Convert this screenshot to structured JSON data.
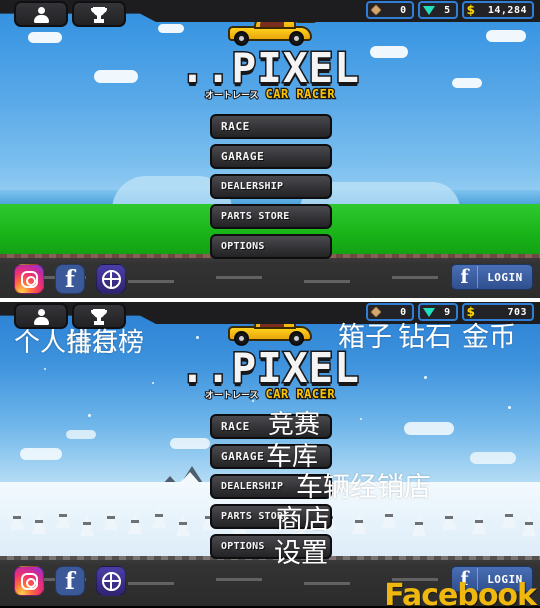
{
  "app": {
    "title": "Pixel Car Racer",
    "logo_main": "PIXEL",
    "logo_prefix": "..",
    "logo_jp": "オートレース",
    "logo_sub": "CAR RACER"
  },
  "colors": {
    "accent_blue": "#2f7fd6",
    "coin_gold": "#ffd900",
    "gem_teal": "#22dfc0",
    "box_tan": "#d4a870",
    "facebook_blue": "#3b5998",
    "menu_button": "#3a3a3e",
    "watermark_gold": "#f0b80e"
  },
  "panels": [
    {
      "id": "summer",
      "scene": "grass-day",
      "topbar": {
        "profile_icon": "person-icon",
        "trophy_icon": "trophy-icon",
        "chips": [
          {
            "icon": "crate-icon",
            "label": "boxes",
            "value": "0"
          },
          {
            "icon": "gem-icon",
            "label": "gems",
            "value": "5"
          },
          {
            "icon": "coin-icon",
            "label": "coins",
            "value": "14,284"
          }
        ]
      },
      "menu": [
        {
          "label": "RACE"
        },
        {
          "label": "GARAGE"
        },
        {
          "label": "DEALERSHIP"
        },
        {
          "label": "PARTS STORE"
        },
        {
          "label": "OPTIONS"
        }
      ],
      "bottombar": {
        "social": [
          {
            "icon": "instagram-icon",
            "label": "Instagram"
          },
          {
            "icon": "facebook-icon",
            "label": "Facebook"
          },
          {
            "icon": "globe-icon",
            "label": "Website"
          }
        ],
        "login": {
          "icon": "facebook-f-icon",
          "label": "LOGIN"
        }
      },
      "annotations": []
    },
    {
      "id": "winter",
      "scene": "snow-mountain",
      "topbar": {
        "profile_icon": "person-icon",
        "trophy_icon": "trophy-icon",
        "chips": [
          {
            "icon": "crate-icon",
            "label": "boxes",
            "value": "0"
          },
          {
            "icon": "gem-icon",
            "label": "gems",
            "value": "9"
          },
          {
            "icon": "coin-icon",
            "label": "coins",
            "value": "703"
          }
        ]
      },
      "menu": [
        {
          "label": "RACE"
        },
        {
          "label": "GARAGE"
        },
        {
          "label": "DEALERSHIP"
        },
        {
          "label": "PARTS STORE"
        },
        {
          "label": "OPTIONS"
        }
      ],
      "bottombar": {
        "social": [
          {
            "icon": "instagram-icon",
            "label": "Instagram"
          },
          {
            "icon": "facebook-icon",
            "label": "Facebook"
          },
          {
            "icon": "globe-icon",
            "label": "Website"
          }
        ],
        "login": {
          "icon": "facebook-f-icon",
          "label": "LOGIN"
        },
        "watermark": "Facebook"
      },
      "annotations": [
        {
          "key": "profile",
          "text": "个人信息"
        },
        {
          "key": "leaderboard",
          "text": "排行榜"
        },
        {
          "key": "boxes",
          "text": "箱子"
        },
        {
          "key": "gems",
          "text": "钻石"
        },
        {
          "key": "coins",
          "text": "金币"
        },
        {
          "key": "race",
          "text": "竞赛"
        },
        {
          "key": "garage",
          "text": "车库"
        },
        {
          "key": "dealership",
          "text": "车辆经销店"
        },
        {
          "key": "parts_store",
          "text": "商店"
        },
        {
          "key": "options",
          "text": "设置"
        }
      ]
    }
  ]
}
